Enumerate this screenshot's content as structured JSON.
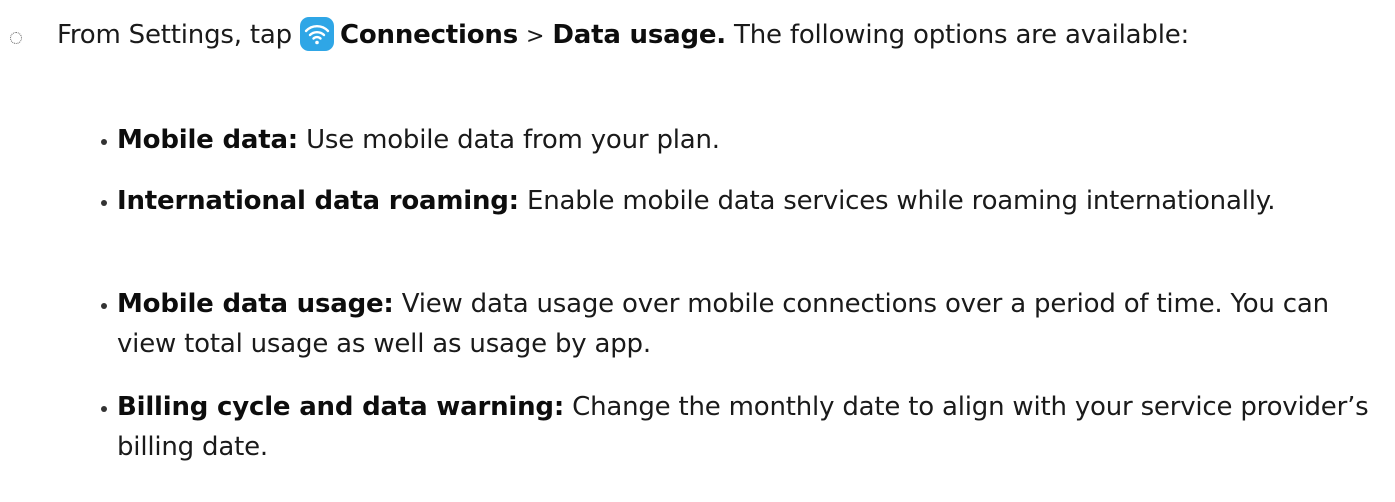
{
  "step": {
    "prefix": "From Settings, tap",
    "connections_label": "Connections",
    "separator": ">",
    "data_usage_label": "Data usage.",
    "suffix": "The following options are available:",
    "icon": "wifi-icon",
    "icon_color": "#2fa6e6"
  },
  "options": [
    {
      "title": "Mobile data:",
      "description": "Use mobile data from your plan."
    },
    {
      "title": "International data roaming:",
      "description": "Enable mobile data services while roaming internationally."
    },
    {
      "title": "Mobile data usage:",
      "description": "View data usage over mobile connections over a period of time. You can view total usage as well as usage by app."
    },
    {
      "title": "Billing cycle and data warning:",
      "description": "Change the monthly date to align with your service provider’s billing date."
    }
  ]
}
